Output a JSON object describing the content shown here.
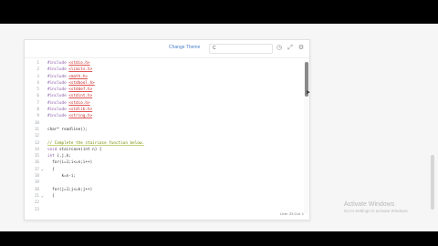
{
  "toolbar": {
    "theme_button": "Change Theme",
    "language_value": "C",
    "icons": [
      "history-icon",
      "fullscreen-icon",
      "settings-icon"
    ]
  },
  "code_lines": [
    {
      "n": "1",
      "fold": "",
      "parts": [
        [
          "kw",
          "#include "
        ],
        [
          "hdr",
          "<stdio.h>"
        ]
      ]
    },
    {
      "n": "2",
      "fold": "",
      "parts": [
        [
          "kw",
          "#include "
        ],
        [
          "hdr",
          "<limits.h>"
        ]
      ]
    },
    {
      "n": "3",
      "fold": "",
      "parts": [
        [
          "kw",
          "#include "
        ],
        [
          "hdr",
          "<math.h>"
        ]
      ]
    },
    {
      "n": "4",
      "fold": "",
      "parts": [
        [
          "kw",
          "#include "
        ],
        [
          "hdr",
          "<stdbool.h>"
        ]
      ]
    },
    {
      "n": "5",
      "fold": "",
      "parts": [
        [
          "kw",
          "#include "
        ],
        [
          "hdr",
          "<stddef.h>"
        ]
      ]
    },
    {
      "n": "6",
      "fold": "",
      "parts": [
        [
          "kw",
          "#include "
        ],
        [
          "hdr",
          "<stdint.h>"
        ]
      ]
    },
    {
      "n": "7",
      "fold": "",
      "parts": [
        [
          "kw",
          "#include "
        ],
        [
          "hdr",
          "<stdio.h>"
        ]
      ]
    },
    {
      "n": "8",
      "fold": "",
      "parts": [
        [
          "kw",
          "#include "
        ],
        [
          "hdr",
          "<stdlib.h>"
        ]
      ]
    },
    {
      "n": "9",
      "fold": "",
      "parts": [
        [
          "kw",
          "#include "
        ],
        [
          "hdr",
          "<string.h>"
        ]
      ]
    },
    {
      "n": "10",
      "fold": "",
      "parts": []
    },
    {
      "n": "11",
      "fold": "",
      "parts": [
        [
          "",
          "char* readline();"
        ]
      ]
    },
    {
      "n": "12",
      "fold": "",
      "parts": []
    },
    {
      "n": "13",
      "fold": "",
      "parts": [
        [
          "cmt",
          "// Complete the staircase function below."
        ]
      ]
    },
    {
      "n": "14",
      "fold": "",
      "parts": [
        [
          "kw",
          "void"
        ],
        [
          "",
          " staircase(int n) {"
        ]
      ]
    },
    {
      "n": "15",
      "fold": "",
      "parts": [
        [
          "kw",
          "int"
        ],
        [
          "",
          " i,j,k;"
        ]
      ]
    },
    {
      "n": "16",
      "fold": "",
      "parts": [
        [
          "",
          "  for(i=1;i<=n;i++)"
        ]
      ]
    },
    {
      "n": "17",
      "fold": "▾",
      "parts": [
        [
          "",
          "  {"
        ]
      ]
    },
    {
      "n": "18",
      "fold": "",
      "parts": [
        [
          "",
          "      k=n-i;"
        ]
      ]
    },
    {
      "n": "19",
      "fold": "",
      "parts": []
    },
    {
      "n": "20",
      "fold": "",
      "parts": [
        [
          "",
          "  for(j=1;j<=k;j++)"
        ]
      ]
    },
    {
      "n": "21",
      "fold": "▾",
      "parts": [
        [
          "",
          "  {"
        ]
      ]
    },
    {
      "n": "22",
      "fold": "",
      "parts": []
    },
    {
      "n": "23",
      "fold": "",
      "parts": []
    }
  ],
  "status": {
    "position": "Line: 33 Col: 1"
  },
  "watermark": {
    "title": "Activate Windows",
    "subtitle": "Go to Settings to activate Windows."
  }
}
